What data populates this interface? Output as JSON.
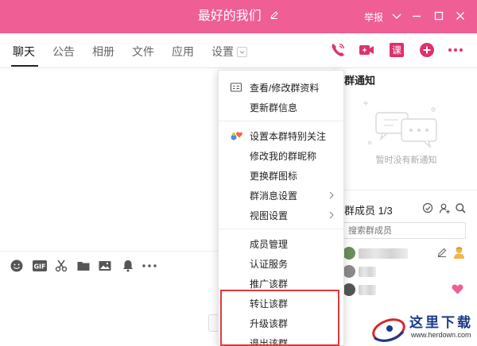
{
  "window": {
    "title": "最好的我们",
    "report_label": "举报",
    "colors": {
      "titlebar": "#ef5e95",
      "accent": "#e0306e",
      "highlight_box": "#e0393a"
    }
  },
  "tabs": [
    {
      "label": "聊天",
      "active": true
    },
    {
      "label": "公告"
    },
    {
      "label": "相册"
    },
    {
      "label": "文件"
    },
    {
      "label": "应用"
    },
    {
      "label": "设置"
    }
  ],
  "toolbar_icons": [
    "phone-icon",
    "video-icon",
    "class-icon",
    "add-icon",
    "more-icon"
  ],
  "toolbar_class_label": "课",
  "settings_menu": {
    "groups": [
      [
        {
          "label": "查看/修改群资料",
          "icon": "card-icon"
        },
        {
          "label": "更新群信息"
        }
      ],
      [
        {
          "label": "设置本群特别关注",
          "icon": "special-care-icon"
        },
        {
          "label": "修改我的群昵称"
        },
        {
          "label": "更换群图标"
        },
        {
          "label": "群消息设置",
          "submenu": true
        },
        {
          "label": "视图设置",
          "submenu": true
        }
      ],
      [
        {
          "label": "成员管理"
        },
        {
          "label": "认证服务"
        },
        {
          "label": "推广该群"
        },
        {
          "label": "转让该群"
        },
        {
          "label": "升级该群"
        },
        {
          "label": "退出该群"
        }
      ]
    ]
  },
  "input_toolbar_icons": [
    "emoji-icon",
    "gif-icon",
    "scissors-icon",
    "folder-icon",
    "image-icon",
    "bell-icon",
    "more-dots-icon"
  ],
  "input_toolbar_gif_label": "GIF",
  "group_notice": {
    "title": "群通知",
    "empty_text": "暂时没有新通知"
  },
  "members": {
    "title": "群成员",
    "count": "1/3",
    "search_placeholder": "搜索群成员",
    "rows": [
      {
        "avatar_color": "#6a8f5a"
      },
      {
        "avatar_color": "#8a8a8a"
      },
      {
        "avatar_color": "#555555"
      }
    ]
  },
  "watermark": {
    "title": "这里下载",
    "url": "www.herdown.com"
  }
}
